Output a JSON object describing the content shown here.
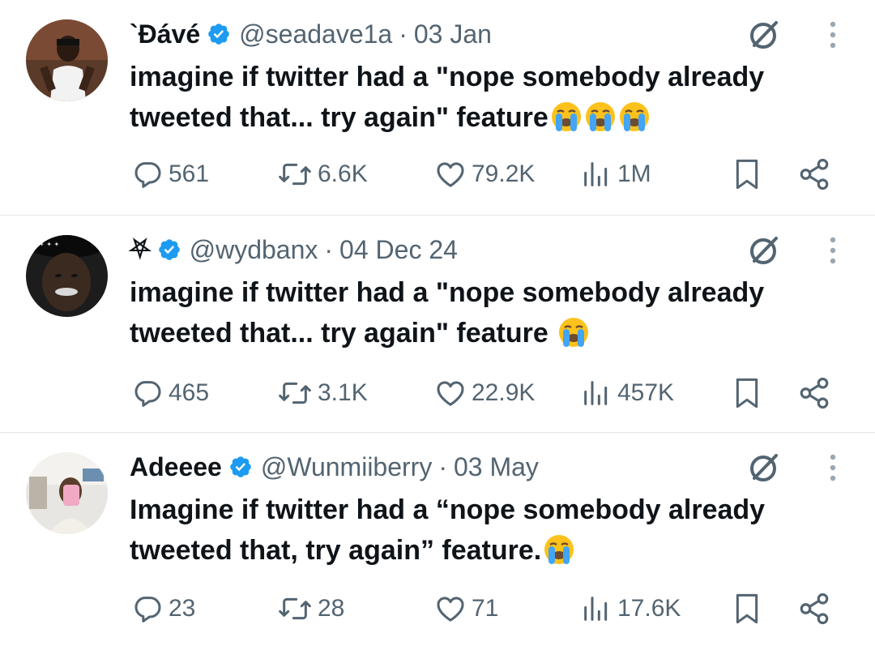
{
  "tweets": [
    {
      "name": "`Ðávé",
      "handle": "@seadave1a",
      "separator": "·",
      "date": "03 Jan",
      "text_lines": [
        "imagine if twitter had a \"nope somebody already",
        "tweeted that... try again\" feature"
      ],
      "emoji_count": 3,
      "replies": "561",
      "retweets": "6.6K",
      "likes": "79.2K",
      "views": "1M"
    },
    {
      "name": "⛧",
      "handle": "@wydbanx",
      "separator": "·",
      "date": "04 Dec 24",
      "text_lines": [
        "imagine if twitter had a \"nope somebody already",
        "tweeted that... try again\" feature"
      ],
      "emoji_count": 1,
      "replies": "465",
      "retweets": "3.1K",
      "likes": "22.9K",
      "views": "457K"
    },
    {
      "name": "Adeeee",
      "handle": "@Wunmiiberry",
      "separator": "·",
      "date": "03 May",
      "text_lines": [
        "Imagine if twitter had a “nope somebody already",
        "tweeted that, try again” feature."
      ],
      "emoji_count": 1,
      "replies": "23",
      "retweets": "28",
      "likes": "71",
      "views": "17.6K"
    }
  ],
  "icons": {
    "verified": "verified-badge-icon",
    "grok": "grok-icon",
    "more": "more-options-icon",
    "reply": "reply-icon",
    "retweet": "retweet-icon",
    "like": "like-heart-icon",
    "views": "views-chart-icon",
    "bookmark": "bookmark-icon",
    "share": "share-icon",
    "emoji": "loudly-crying-face-emoji"
  },
  "colors": {
    "verified": "#1d9bf0",
    "text": "#0f1419",
    "secondary": "#536471",
    "divider": "#e3e6e9"
  }
}
